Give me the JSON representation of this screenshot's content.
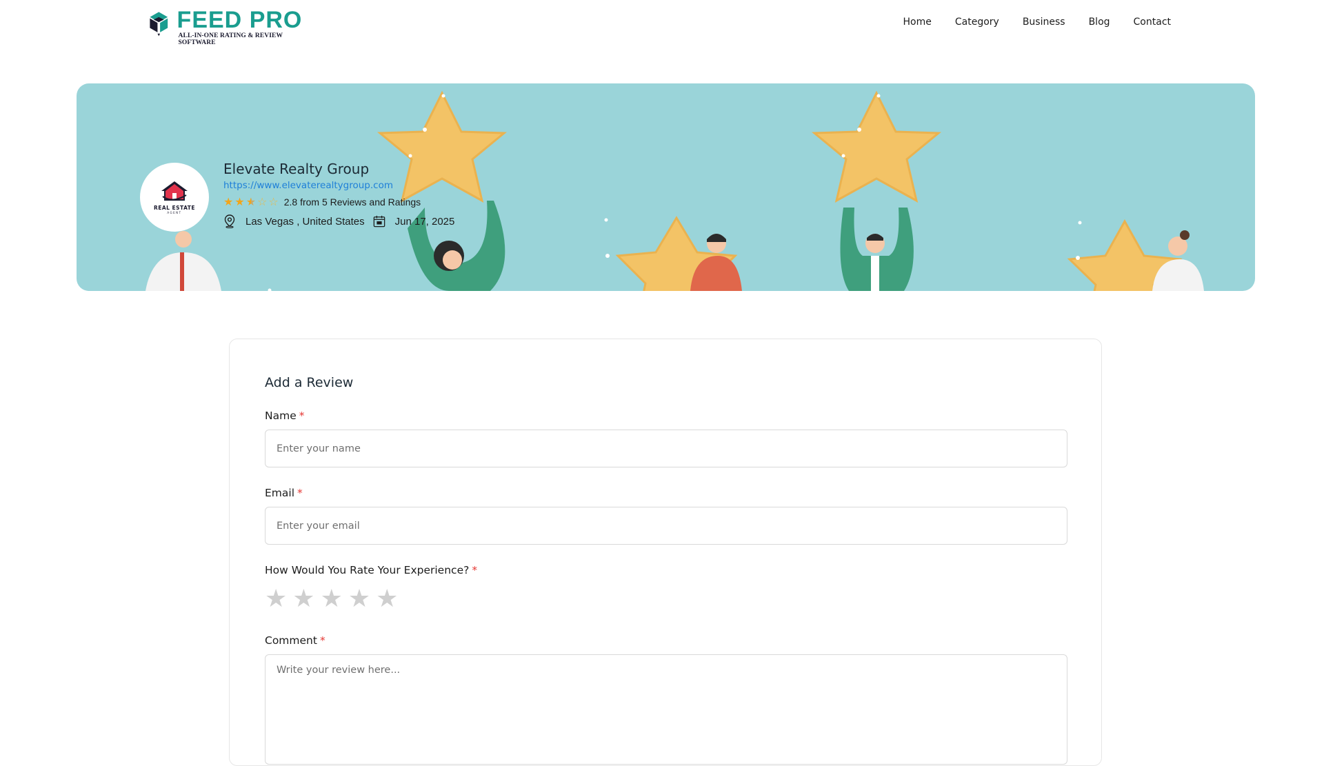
{
  "brand": {
    "logo_title_a": "FEED",
    "logo_title_b": "PRO",
    "logo_subtitle": "ALL-IN-ONE RATING & REVIEW SOFTWARE",
    "primary_color": "#1a9d8f"
  },
  "nav": {
    "items": [
      {
        "label": "Home"
      },
      {
        "label": "Category"
      },
      {
        "label": "Business"
      },
      {
        "label": "Blog"
      },
      {
        "label": "Contact"
      }
    ]
  },
  "business": {
    "name": "Elevate Realty Group",
    "url": "https://www.elevaterealtygroup.com",
    "rating": 2.8,
    "rating_text": "2.8 from 5 Reviews and Ratings",
    "stars": [
      "full",
      "full",
      "half",
      "empty",
      "empty"
    ],
    "star_color": "#f2a51a",
    "location": "Las Vegas , United States",
    "date": "Jun 17, 2025",
    "avatar_text": "REAL ESTATE",
    "avatar_subtext": "AGENT",
    "location_icon": "map-pin-icon",
    "date_icon": "calendar-icon",
    "banner_color": "#9ad4d9"
  },
  "form": {
    "title": "Add a Review",
    "name_label": "Name",
    "name_placeholder": "Enter your name",
    "email_label": "Email",
    "email_placeholder": "Enter your email",
    "rating_label": "How Would You Rate Your Experience?",
    "rating_star_count": 5,
    "comment_label": "Comment",
    "comment_placeholder": "Write your review here...",
    "required_mark": "*",
    "required_color": "#e53935"
  }
}
